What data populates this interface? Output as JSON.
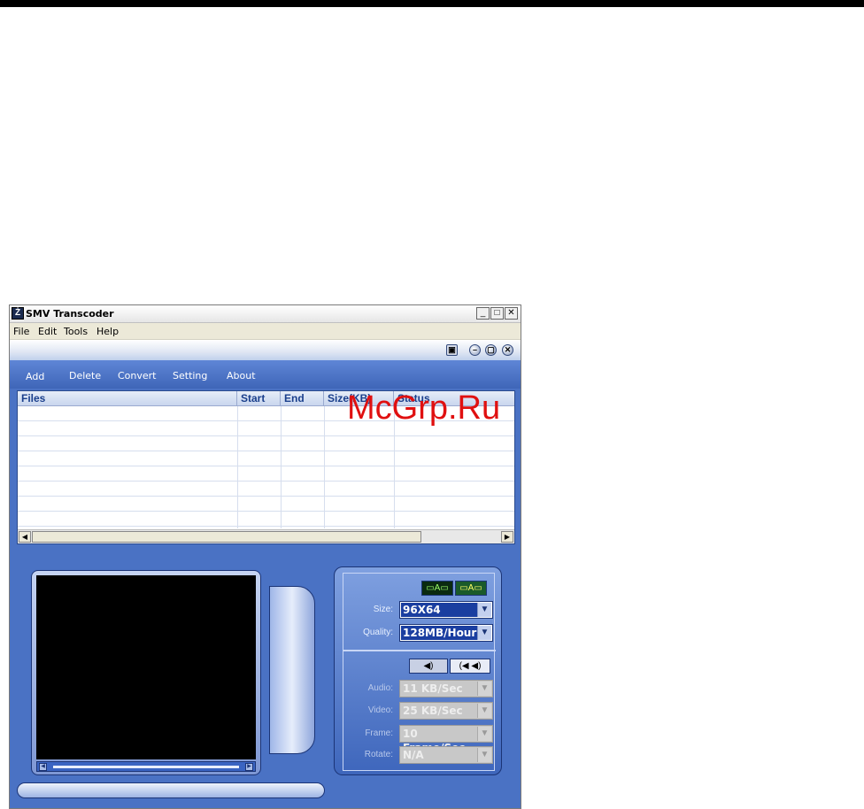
{
  "window": {
    "title": "SMV Transcoder",
    "app_icon_glyph": "Ż",
    "controls": {
      "minimize": "_",
      "maximize": "□",
      "close": "✕"
    }
  },
  "menu": [
    "File",
    "Edit",
    "Tools",
    "Help"
  ],
  "skin_controls": {
    "save": "▣",
    "minimize": "–",
    "restore": "▢",
    "close": "✕"
  },
  "toolbar": [
    "Add",
    "Delete",
    "Convert",
    "Setting",
    "About"
  ],
  "file_grid": {
    "columns": [
      "Files",
      "Start",
      "End",
      "Size(KB)",
      "Status"
    ],
    "row_count": 8
  },
  "watermark": "McGrp.Ru",
  "video_mode_buttons": {
    "fit": "▭A▭",
    "stretch": "▭A▭"
  },
  "audio_mode_buttons": {
    "mono": "◀)",
    "stereo": "(◀ ◀)"
  },
  "settings": {
    "size": {
      "label": "Size:",
      "value": "96X64"
    },
    "quality": {
      "label": "Quality:",
      "value": "128MB/Hour"
    },
    "audio": {
      "label": "Audio:",
      "value": "11 KB/Sec"
    },
    "video": {
      "label": "Video:",
      "value": "25 KB/Sec"
    },
    "frame": {
      "label": "Frame:",
      "value": "10 Frame/Sec"
    },
    "rotate": {
      "label": "Rotate:",
      "value": "N/A"
    }
  },
  "colors": {
    "skin_blue": "#4a72c4",
    "header_text": "#1a3f8c",
    "combo_selected": "#1a3ea0",
    "watermark": "#e01010"
  }
}
